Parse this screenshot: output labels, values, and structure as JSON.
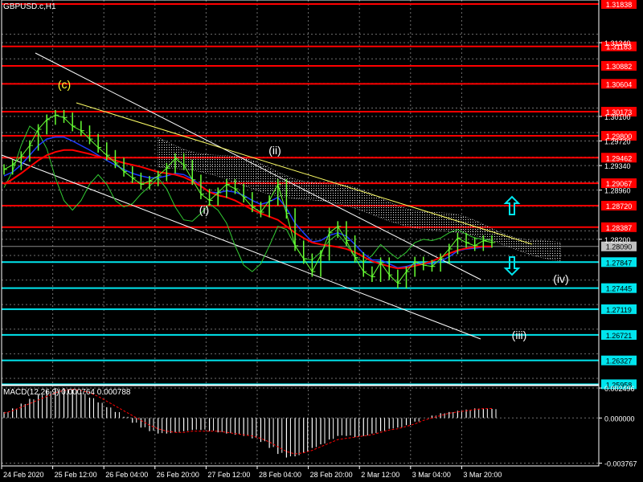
{
  "symbol_title": "GBPUSD.c,H1",
  "macd_title": "MACD(12,26,9) 0.000764 0.000788",
  "colors": {
    "background": "#000000",
    "grid": "#6f6f6f",
    "resistance": "#ff0000",
    "support": "#00e5ee",
    "price": "#66ff33",
    "ma_red": "#ff0000",
    "ma_blue": "#1f3cff",
    "ma_green": "#33cc33",
    "channel": "#ffffff",
    "trendline": "#ffff66",
    "wave_c": "#ffff33",
    "waves": "#ffffff",
    "macd_hist": "#ffffff",
    "macd_signal": "#ff0000",
    "current_label_bg": "#c0c0c0"
  },
  "chart_data": [
    {
      "type": "line",
      "title": "GBPUSD.c,H1",
      "x_ticks": [
        "24 Feb 2020",
        "25 Feb 12:00",
        "26 Feb 04:00",
        "26 Feb 20:00",
        "27 Feb 12:00",
        "28 Feb 04:00",
        "28 Feb 20:00",
        "2 Mar 12:00",
        "3 Mar 04:00",
        "3 Mar 20:00"
      ],
      "y_ticks": [
        "1.31240",
        "1.30100",
        "1.29720",
        "1.29340",
        "1.28960",
        "1.28200"
      ],
      "ylim": [
        1.2595,
        1.319
      ],
      "current_price": "1.28090",
      "resistance_levels": [
        "1.31838",
        "1.31183",
        "1.30882",
        "1.30604",
        "1.30173",
        "1.29800",
        "1.29462",
        "1.29067",
        "1.28720",
        "1.28387"
      ],
      "support_levels": [
        "1.27847",
        "1.27445",
        "1.27119",
        "1.26721",
        "1.26327",
        "1.25958"
      ],
      "wave_labels": [
        "(c)",
        "(i)",
        "(ii)",
        "(iii)",
        "(iv)"
      ],
      "arrows": [
        "up-arrow",
        "down-arrow"
      ],
      "grid": true,
      "price_series": [
        1.2928,
        1.2935,
        1.2948,
        1.2965,
        1.299,
        1.3005,
        1.3012,
        1.3008,
        1.2995,
        1.2988,
        1.2975,
        1.2962,
        1.295,
        1.2938,
        1.2925,
        1.2915,
        1.2905,
        1.291,
        1.2918,
        1.293,
        1.2945,
        1.2935,
        1.2912,
        1.289,
        1.288,
        1.2892,
        1.2905,
        1.2898,
        1.2885,
        1.287,
        1.2862,
        1.288,
        1.2905,
        1.286,
        1.281,
        1.279,
        1.277,
        1.2795,
        1.283,
        1.284,
        1.2818,
        1.2792,
        1.277,
        1.2762,
        1.2784,
        1.2765,
        1.2752,
        1.277,
        1.2785,
        1.278,
        1.2778,
        1.279,
        1.2805,
        1.2822,
        1.2815,
        1.281,
        1.2818,
        1.2815
      ],
      "ma_red": [
        1.2905,
        1.2913,
        1.2922,
        1.2932,
        1.2942,
        1.295,
        1.2955,
        1.2958,
        1.2958,
        1.2955,
        1.2952,
        1.2948,
        1.2945,
        1.2942,
        1.2938,
        1.2935,
        1.2932,
        1.2928,
        1.2924,
        1.2922,
        1.292,
        1.2916,
        1.291,
        1.2902,
        1.2893,
        1.2888,
        1.2885,
        1.288,
        1.2873,
        1.2866,
        1.286,
        1.2855,
        1.285,
        1.284,
        1.283,
        1.2822,
        1.2815,
        1.2812,
        1.281,
        1.2808,
        1.2805,
        1.28,
        1.2793,
        1.2786,
        1.2782,
        1.2778,
        1.2775,
        1.2776,
        1.2779,
        1.2782,
        1.2786,
        1.2792,
        1.2798,
        1.2803,
        1.2806,
        1.2808,
        1.2809,
        1.2809
      ],
      "ma_blue": [
        1.2918,
        1.2924,
        1.2935,
        1.295,
        1.2965,
        1.2975,
        1.2978,
        1.2978,
        1.2972,
        1.2965,
        1.2958,
        1.295,
        1.2942,
        1.2935,
        1.2928,
        1.2922,
        1.2918,
        1.2915,
        1.2915,
        1.2918,
        1.2922,
        1.292,
        1.2913,
        1.2903,
        1.2893,
        1.2892,
        1.2895,
        1.2893,
        1.2888,
        1.288,
        1.2874,
        1.2878,
        1.2885,
        1.2868,
        1.2845,
        1.283,
        1.2816,
        1.2818,
        1.2826,
        1.283,
        1.2825,
        1.2812,
        1.2798,
        1.2788,
        1.2788,
        1.2782,
        1.2776,
        1.2778,
        1.2782,
        1.2783,
        1.2782,
        1.2786,
        1.2793,
        1.2802,
        1.2805,
        1.2806,
        1.2808,
        1.2808
      ],
      "ma_green": [
        1.29,
        1.2925,
        1.2965,
        1.2995,
        1.2985,
        1.296,
        1.2915,
        1.288,
        1.2865,
        1.288,
        1.2905,
        1.292,
        1.2905,
        1.288,
        1.287,
        1.2875,
        1.289,
        1.2902,
        1.2915,
        1.2898,
        1.287,
        1.285,
        1.2848,
        1.286,
        1.2875,
        1.2865,
        1.2845,
        1.281,
        1.278,
        1.277,
        1.2782,
        1.281,
        1.284,
        1.2835,
        1.281,
        1.279,
        1.2788,
        1.28,
        1.2818,
        1.2828,
        1.2812,
        1.2792,
        1.2785,
        1.2795,
        1.2812,
        1.28,
        1.279,
        1.28,
        1.2815,
        1.282,
        1.2818,
        1.2822,
        1.283,
        1.2835,
        1.2828,
        1.2822,
        1.282,
        1.2818
      ]
    },
    {
      "type": "bar",
      "title": "MACD(12,26,9) 0.000764 0.000788",
      "y_ticks": [
        "0.002496",
        "0.000000",
        "-0.003767"
      ],
      "ylim": [
        -0.004,
        0.0027
      ],
      "histogram": [
        0.0005,
        0.0008,
        0.0012,
        0.0016,
        0.002,
        0.0023,
        0.0025,
        0.0025,
        0.0024,
        0.0021,
        0.0017,
        0.0013,
        0.0009,
        0.0005,
        0.0001,
        -0.0004,
        -0.0008,
        -0.0011,
        -0.0013,
        -0.0013,
        -0.0012,
        -0.0011,
        -0.001,
        -0.001,
        -0.0011,
        -0.0012,
        -0.0013,
        -0.0014,
        -0.0015,
        -0.0017,
        -0.002,
        -0.0025,
        -0.003,
        -0.0033,
        -0.0032,
        -0.0029,
        -0.0025,
        -0.0022,
        -0.0018,
        -0.0015,
        -0.0015,
        -0.0016,
        -0.0015,
        -0.0013,
        -0.0011,
        -0.0009,
        -0.0008,
        -0.0006,
        -0.0003,
        0.0,
        0.0002,
        0.0004,
        0.0005,
        0.0006,
        0.0007,
        0.0008,
        0.00079,
        0.00076
      ],
      "signal": [
        0.0004,
        0.0006,
        0.0009,
        0.0012,
        0.0015,
        0.0018,
        0.0021,
        0.0023,
        0.0024,
        0.0023,
        0.0021,
        0.0018,
        0.0014,
        0.001,
        0.0006,
        0.0002,
        -0.0002,
        -0.0006,
        -0.0009,
        -0.0011,
        -0.0012,
        -0.0012,
        -0.0011,
        -0.0011,
        -0.0011,
        -0.0011,
        -0.0012,
        -0.0013,
        -0.0014,
        -0.0015,
        -0.0017,
        -0.002,
        -0.0024,
        -0.0028,
        -0.003,
        -0.0029,
        -0.0027,
        -0.0024,
        -0.0021,
        -0.0018,
        -0.0017,
        -0.0016,
        -0.0015,
        -0.0014,
        -0.0012,
        -0.001,
        -0.0009,
        -0.0007,
        -0.0005,
        -0.0002,
        0.0,
        0.0002,
        0.0004,
        0.0005,
        0.0006,
        0.0007,
        0.00078,
        0.00079
      ]
    }
  ]
}
